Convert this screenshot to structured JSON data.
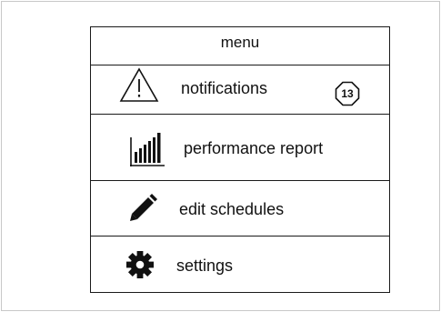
{
  "menu": {
    "title": "menu",
    "items": [
      {
        "label": "notifications",
        "icon": "warning-icon",
        "badge": "13"
      },
      {
        "label": "performance report",
        "icon": "bar-chart-icon"
      },
      {
        "label": "edit schedules",
        "icon": "pencil-icon"
      },
      {
        "label": "settings",
        "icon": "gear-icon"
      }
    ]
  }
}
